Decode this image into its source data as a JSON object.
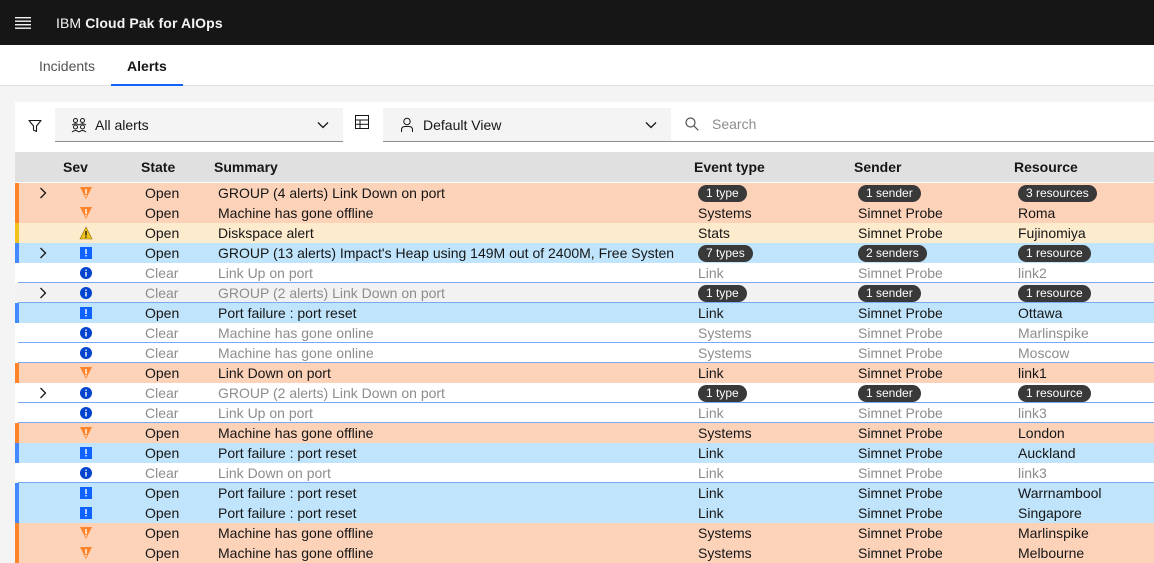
{
  "header": {
    "brand_prefix": "IBM",
    "brand_name": "Cloud Pak for AIOps"
  },
  "tabs": [
    {
      "label": "Incidents",
      "active": false
    },
    {
      "label": "Alerts",
      "active": true
    }
  ],
  "toolbar": {
    "alerts_filter": "All alerts",
    "view_select": "Default View",
    "search_placeholder": "Search"
  },
  "columns": {
    "sev": "Sev",
    "state": "State",
    "summary": "Summary",
    "event_type": "Event type",
    "sender": "Sender",
    "resource": "Resource"
  },
  "colors": {
    "critical": "#ff832b",
    "major": "#f1c21b",
    "minor": "#0f62fe",
    "info": "#0043ce",
    "accent": "#0f62fe"
  },
  "rows": [
    {
      "group": true,
      "sev": "critical",
      "state": "Open",
      "summary": "GROUP (4 alerts) Link Down on port",
      "event_type": "1 type",
      "sender": "1 sender",
      "resource": "3 resources",
      "style": "cr"
    },
    {
      "group": false,
      "sev": "critical",
      "state": "Open",
      "summary": "Machine has gone offline",
      "event_type": "Systems",
      "sender": "Simnet Probe",
      "resource": "Roma",
      "style": "cr"
    },
    {
      "group": false,
      "sev": "major",
      "state": "Open",
      "summary": "Diskspace alert",
      "event_type": "Stats",
      "sender": "Simnet Probe",
      "resource": "Fujinomiya",
      "style": "mj"
    },
    {
      "group": true,
      "sev": "minor",
      "state": "Open",
      "summary": "GROUP (13 alerts) Impact's Heap using 149M out of 2400M, Free Systen",
      "event_type": "7 types",
      "sender": "2 senders",
      "resource": "1 resource",
      "style": "mn"
    },
    {
      "group": false,
      "sev": "info",
      "state": "Clear",
      "summary": "Link Up on port",
      "event_type": "Link",
      "sender": "Simnet Probe",
      "resource": "link2",
      "style": "cl"
    },
    {
      "group": true,
      "sev": "info",
      "state": "Clear",
      "summary": "GROUP (2 alerts) Link Down on port",
      "event_type": "1 type",
      "sender": "1 sender",
      "resource": "1 resource",
      "style": "gr"
    },
    {
      "group": false,
      "sev": "minor",
      "state": "Open",
      "summary": "Port failure : port reset",
      "event_type": "Link",
      "sender": "Simnet Probe",
      "resource": "Ottawa",
      "style": "mn"
    },
    {
      "group": false,
      "sev": "info",
      "state": "Clear",
      "summary": "Machine has gone online",
      "event_type": "Systems",
      "sender": "Simnet Probe",
      "resource": "Marlinspike",
      "style": "cl"
    },
    {
      "group": false,
      "sev": "info",
      "state": "Clear",
      "summary": "Machine has gone online",
      "event_type": "Systems",
      "sender": "Simnet Probe",
      "resource": "Moscow",
      "style": "cl"
    },
    {
      "group": false,
      "sev": "critical",
      "state": "Open",
      "summary": "Link Down on port",
      "event_type": "Link",
      "sender": "Simnet Probe",
      "resource": "link1",
      "style": "cr"
    },
    {
      "group": true,
      "sev": "info",
      "state": "Clear",
      "summary": "GROUP (2 alerts) Link Down on port",
      "event_type": "1 type",
      "sender": "1 sender",
      "resource": "1 resource",
      "style": "cl"
    },
    {
      "group": false,
      "sev": "info",
      "state": "Clear",
      "summary": "Link Up on port",
      "event_type": "Link",
      "sender": "Simnet Probe",
      "resource": "link3",
      "style": "cl"
    },
    {
      "group": false,
      "sev": "critical",
      "state": "Open",
      "summary": "Machine has gone offline",
      "event_type": "Systems",
      "sender": "Simnet Probe",
      "resource": "London",
      "style": "cr"
    },
    {
      "group": false,
      "sev": "minor",
      "state": "Open",
      "summary": "Port failure : port reset",
      "event_type": "Link",
      "sender": "Simnet Probe",
      "resource": "Auckland",
      "style": "mn"
    },
    {
      "group": false,
      "sev": "info",
      "state": "Clear",
      "summary": "Link Down on port",
      "event_type": "Link",
      "sender": "Simnet Probe",
      "resource": "link3",
      "style": "cl"
    },
    {
      "group": false,
      "sev": "minor",
      "state": "Open",
      "summary": "Port failure : port reset",
      "event_type": "Link",
      "sender": "Simnet Probe",
      "resource": "Warrnambool",
      "style": "mn"
    },
    {
      "group": false,
      "sev": "minor",
      "state": "Open",
      "summary": "Port failure : port reset",
      "event_type": "Link",
      "sender": "Simnet Probe",
      "resource": "Singapore",
      "style": "mn"
    },
    {
      "group": false,
      "sev": "critical",
      "state": "Open",
      "summary": "Machine has gone offline",
      "event_type": "Systems",
      "sender": "Simnet Probe",
      "resource": "Marlinspike",
      "style": "cr"
    },
    {
      "group": false,
      "sev": "critical",
      "state": "Open",
      "summary": "Machine has gone offline",
      "event_type": "Systems",
      "sender": "Simnet Probe",
      "resource": "Melbourne",
      "style": "cr"
    }
  ]
}
